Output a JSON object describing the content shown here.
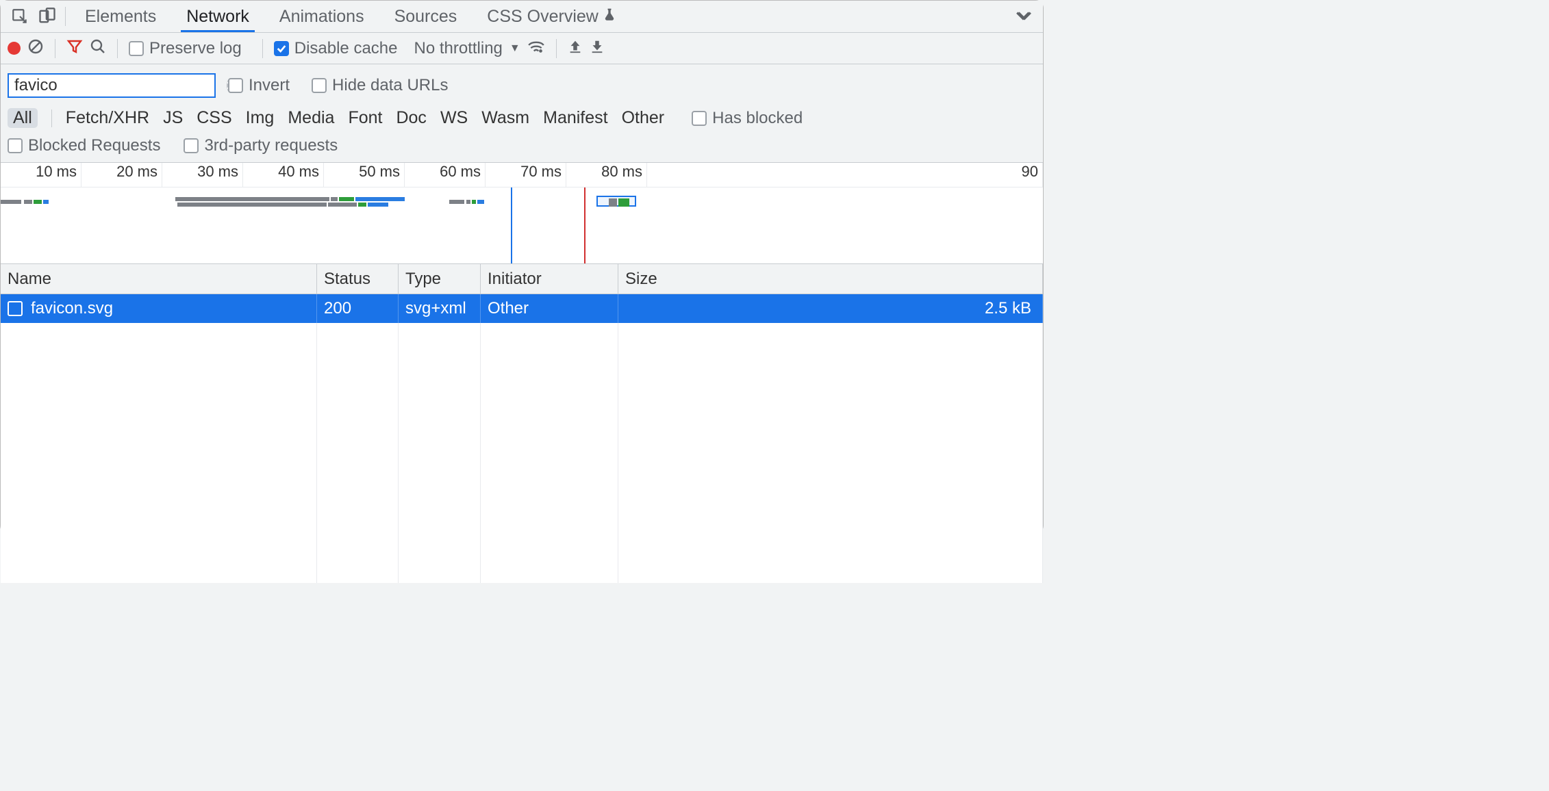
{
  "tabs": [
    "Elements",
    "Network",
    "Animations",
    "Sources",
    "CSS Overview"
  ],
  "active_tab_index": 1,
  "toolbar": {
    "preserve_log_label": "Preserve log",
    "preserve_log_checked": false,
    "disable_cache_label": "Disable cache",
    "disable_cache_checked": true,
    "throttling_label": "No throttling"
  },
  "filter": {
    "value": "favico",
    "invert_label": "Invert",
    "invert_checked": false,
    "hide_data_urls_label": "Hide data URLs",
    "hide_data_urls_checked": false
  },
  "type_filters": [
    "All",
    "Fetch/XHR",
    "JS",
    "CSS",
    "Img",
    "Media",
    "Font",
    "Doc",
    "WS",
    "Wasm",
    "Manifest",
    "Other"
  ],
  "active_type_filter_index": 0,
  "has_blocked_label": "Has blocked",
  "has_blocked_checked": false,
  "blocked_requests_label": "Blocked Requests",
  "blocked_requests_checked": false,
  "third_party_label": "3rd-party requests",
  "third_party_checked": false,
  "timeline_ticks": [
    "10 ms",
    "20 ms",
    "30 ms",
    "40 ms",
    "50 ms",
    "60 ms",
    "70 ms",
    "80 ms",
    "90 "
  ],
  "columns": {
    "name": "Name",
    "status": "Status",
    "type": "Type",
    "initiator": "Initiator",
    "size": "Size"
  },
  "rows": [
    {
      "name": "favicon.svg",
      "status": "200",
      "type": "svg+xml",
      "initiator": "Other",
      "size": "2.5 kB"
    }
  ]
}
